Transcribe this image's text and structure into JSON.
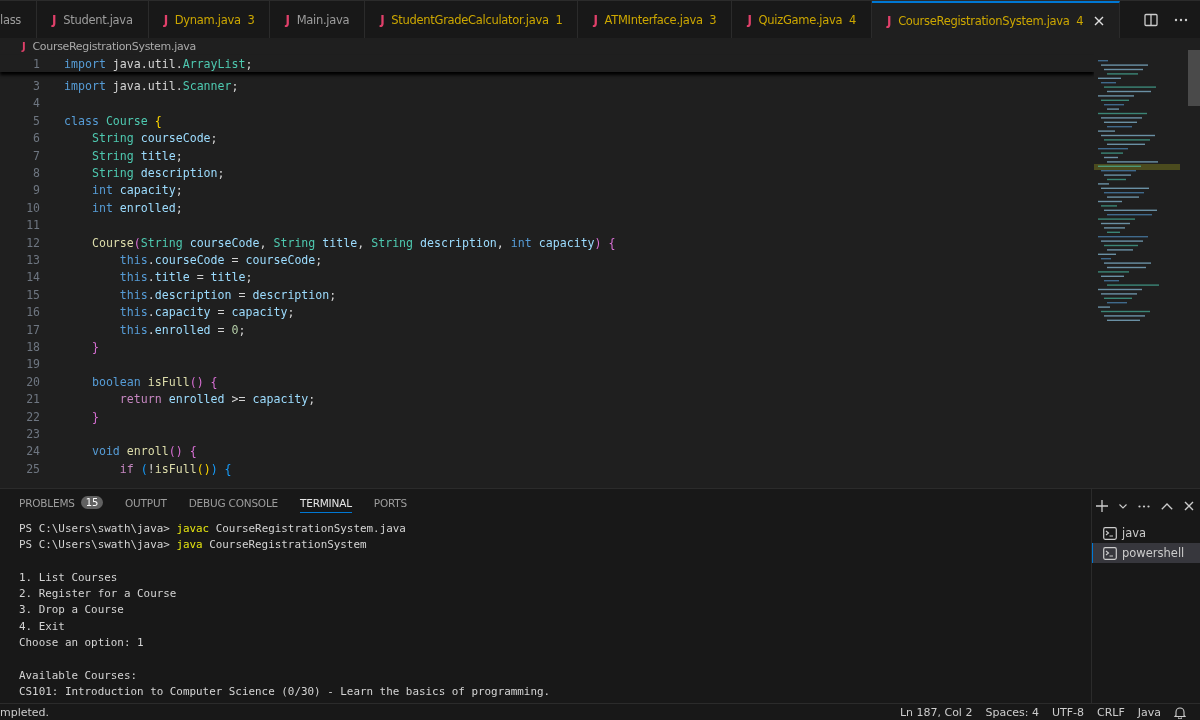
{
  "tabs": [
    {
      "label": "lass",
      "warning": false,
      "selected": false
    },
    {
      "icon": "J",
      "label": "Student.java",
      "warning": false,
      "selected": false
    },
    {
      "icon": "J",
      "label": "Dynam.java",
      "badge": "3",
      "warning": true,
      "selected": false
    },
    {
      "icon": "J",
      "label": "Main.java",
      "warning": false,
      "selected": false
    },
    {
      "icon": "J",
      "label": "StudentGradeCalculator.java",
      "badge": "1",
      "warning": true,
      "selected": false
    },
    {
      "icon": "J",
      "label": "ATMInterface.java",
      "badge": "3",
      "warning": true,
      "selected": false
    },
    {
      "icon": "J",
      "label": "QuizGame.java",
      "badge": "4",
      "warning": true,
      "selected": false
    },
    {
      "icon": "J",
      "label": "CourseRegistrationSystem.java",
      "badge": "4",
      "warning": true,
      "selected": true
    }
  ],
  "breadcrumb": {
    "icon": "J",
    "label": "CourseRegistrationSystem.java"
  },
  "sticky_line": {
    "number": "1",
    "tokens": [
      {
        "kind": "kw",
        "text": "import"
      },
      {
        "kind": "plain",
        "text": " java.util."
      },
      {
        "kind": "type",
        "text": "ArrayList"
      },
      {
        "kind": "plain",
        "text": ";"
      }
    ]
  },
  "code_lines": [
    {
      "number": "3",
      "tokens": [
        {
          "kind": "kw",
          "text": "import"
        },
        {
          "kind": "plain",
          "text": " java.util."
        },
        {
          "kind": "type",
          "text": "Scanner"
        },
        {
          "kind": "plain",
          "text": ";"
        }
      ]
    },
    {
      "number": "4"
    },
    {
      "number": "5",
      "tokens": [
        {
          "kind": "kw",
          "text": "class"
        },
        {
          "kind": "type",
          "text": " Course"
        },
        {
          "kind": "b1",
          "text": " {"
        }
      ]
    },
    {
      "number": "6",
      "tokens": [
        {
          "kind": "type",
          "text": "    String"
        },
        {
          "kind": "var",
          "text": " courseCode"
        },
        {
          "kind": "plain",
          "text": ";"
        }
      ]
    },
    {
      "number": "7",
      "tokens": [
        {
          "kind": "type",
          "text": "    String"
        },
        {
          "kind": "var",
          "text": " title"
        },
        {
          "kind": "plain",
          "text": ";"
        }
      ]
    },
    {
      "number": "8",
      "tokens": [
        {
          "kind": "type",
          "text": "    String"
        },
        {
          "kind": "var",
          "text": " description"
        },
        {
          "kind": "plain",
          "text": ";"
        }
      ]
    },
    {
      "number": "9",
      "tokens": [
        {
          "kind": "kw",
          "text": "    int"
        },
        {
          "kind": "var",
          "text": " capacity"
        },
        {
          "kind": "plain",
          "text": ";"
        }
      ]
    },
    {
      "number": "10",
      "tokens": [
        {
          "kind": "kw",
          "text": "    int"
        },
        {
          "kind": "var",
          "text": " enrolled"
        },
        {
          "kind": "plain",
          "text": ";"
        }
      ]
    },
    {
      "number": "11"
    },
    {
      "number": "12",
      "tokens": [
        {
          "kind": "fn",
          "text": "    Course"
        },
        {
          "kind": "b2",
          "text": "("
        },
        {
          "kind": "type",
          "text": "String"
        },
        {
          "kind": "var",
          "text": " courseCode"
        },
        {
          "kind": "plain",
          "text": ", "
        },
        {
          "kind": "type",
          "text": "String"
        },
        {
          "kind": "var",
          "text": " title"
        },
        {
          "kind": "plain",
          "text": ", "
        },
        {
          "kind": "type",
          "text": "String"
        },
        {
          "kind": "var",
          "text": " description"
        },
        {
          "kind": "plain",
          "text": ", "
        },
        {
          "kind": "kw",
          "text": "int"
        },
        {
          "kind": "var",
          "text": " capacity"
        },
        {
          "kind": "b2",
          "text": ") {"
        }
      ]
    },
    {
      "number": "13",
      "tokens": [
        {
          "kind": "kw",
          "text": "        this"
        },
        {
          "kind": "plain",
          "text": "."
        },
        {
          "kind": "var",
          "text": "courseCode"
        },
        {
          "kind": "plain",
          "text": " = "
        },
        {
          "kind": "var",
          "text": "courseCode"
        },
        {
          "kind": "plain",
          "text": ";"
        }
      ]
    },
    {
      "number": "14",
      "tokens": [
        {
          "kind": "kw",
          "text": "        this"
        },
        {
          "kind": "plain",
          "text": "."
        },
        {
          "kind": "var",
          "text": "title"
        },
        {
          "kind": "plain",
          "text": " = "
        },
        {
          "kind": "var",
          "text": "title"
        },
        {
          "kind": "plain",
          "text": ";"
        }
      ]
    },
    {
      "number": "15",
      "tokens": [
        {
          "kind": "kw",
          "text": "        this"
        },
        {
          "kind": "plain",
          "text": "."
        },
        {
          "kind": "var",
          "text": "description"
        },
        {
          "kind": "plain",
          "text": " = "
        },
        {
          "kind": "var",
          "text": "description"
        },
        {
          "kind": "plain",
          "text": ";"
        }
      ]
    },
    {
      "number": "16",
      "tokens": [
        {
          "kind": "kw",
          "text": "        this"
        },
        {
          "kind": "plain",
          "text": "."
        },
        {
          "kind": "var",
          "text": "capacity"
        },
        {
          "kind": "plain",
          "text": " = "
        },
        {
          "kind": "var",
          "text": "capacity"
        },
        {
          "kind": "plain",
          "text": ";"
        }
      ]
    },
    {
      "number": "17",
      "tokens": [
        {
          "kind": "kw",
          "text": "        this"
        },
        {
          "kind": "plain",
          "text": "."
        },
        {
          "kind": "var",
          "text": "enrolled"
        },
        {
          "kind": "plain",
          "text": " = "
        },
        {
          "kind": "num",
          "text": "0"
        },
        {
          "kind": "plain",
          "text": ";"
        }
      ]
    },
    {
      "number": "18",
      "tokens": [
        {
          "kind": "b2",
          "text": "    }"
        }
      ]
    },
    {
      "number": "19"
    },
    {
      "number": "20",
      "tokens": [
        {
          "kind": "kw",
          "text": "    boolean"
        },
        {
          "kind": "fn",
          "text": " isFull"
        },
        {
          "kind": "b2",
          "text": "() {"
        }
      ]
    },
    {
      "number": "21",
      "tokens": [
        {
          "kind": "ctrl",
          "text": "        return"
        },
        {
          "kind": "var",
          "text": " enrolled"
        },
        {
          "kind": "plain",
          "text": " >= "
        },
        {
          "kind": "var",
          "text": "capacity"
        },
        {
          "kind": "plain",
          "text": ";"
        }
      ]
    },
    {
      "number": "22",
      "tokens": [
        {
          "kind": "b2",
          "text": "    }"
        }
      ]
    },
    {
      "number": "23"
    },
    {
      "number": "24",
      "tokens": [
        {
          "kind": "kw",
          "text": "    void"
        },
        {
          "kind": "fn",
          "text": " enroll"
        },
        {
          "kind": "b2",
          "text": "() {"
        }
      ]
    },
    {
      "number": "25",
      "tokens": [
        {
          "kind": "ctrl",
          "text": "        if"
        },
        {
          "kind": "b3",
          "text": " ("
        },
        {
          "kind": "plain",
          "text": "!"
        },
        {
          "kind": "fn",
          "text": "isFull"
        },
        {
          "kind": "b1",
          "text": "()"
        },
        {
          "kind": "b3",
          "text": ") {"
        }
      ]
    }
  ],
  "panel_tabs": [
    {
      "label": "PROBLEMS",
      "badge": "15",
      "selected": false
    },
    {
      "label": "OUTPUT",
      "selected": false
    },
    {
      "label": "DEBUG CONSOLE",
      "selected": false
    },
    {
      "label": "TERMINAL",
      "selected": true
    },
    {
      "label": "PORTS",
      "selected": false
    }
  ],
  "terminal_blocks": [
    {
      "lines": [
        {
          "tokens": [
            {
              "kind": "plain",
              "text": "PS C:\\Users\\swath\\java> "
            },
            {
              "kind": "cmd",
              "text": "javac"
            },
            {
              "kind": "plain",
              "text": " CourseRegistrationSystem.java"
            }
          ]
        },
        {
          "tokens": [
            {
              "kind": "plain",
              "text": "PS C:\\Users\\swath\\java> "
            },
            {
              "kind": "cmd",
              "text": "java"
            },
            {
              "kind": "plain",
              "text": " CourseRegistrationSystem"
            }
          ]
        }
      ]
    },
    {
      "lines": [
        {
          "tokens": [
            {
              "kind": "plain",
              "text": "1. List Courses"
            }
          ]
        },
        {
          "tokens": [
            {
              "kind": "plain",
              "text": "2. Register for a Course"
            }
          ]
        },
        {
          "tokens": [
            {
              "kind": "plain",
              "text": "3. Drop a Course"
            }
          ]
        },
        {
          "tokens": [
            {
              "kind": "plain",
              "text": "4. Exit"
            }
          ]
        },
        {
          "tokens": [
            {
              "kind": "plain",
              "text": "Choose an option: 1"
            }
          ]
        }
      ]
    },
    {
      "lines": [
        {
          "tokens": [
            {
              "kind": "plain",
              "text": "Available Courses:"
            }
          ]
        },
        {
          "tokens": [
            {
              "kind": "plain",
              "text": "CS101: Introduction to Computer Science (0/30) - Learn the basics of programming."
            }
          ]
        }
      ]
    }
  ],
  "terminals": [
    {
      "label": "java",
      "selected": false
    },
    {
      "label": "powershell",
      "selected": true
    }
  ],
  "status_bar": {
    "left": "mpleted.",
    "items": [
      "Ln 187, Col 2",
      "Spaces: 4",
      "UTF-8",
      "CRLF",
      "Java"
    ]
  }
}
